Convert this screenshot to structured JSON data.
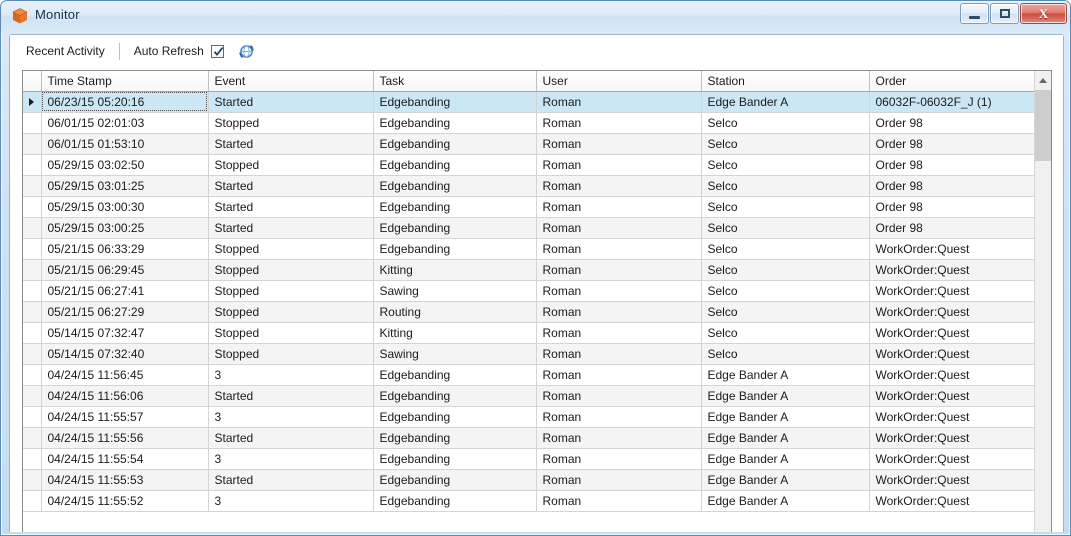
{
  "window": {
    "title": "Monitor",
    "icon": "cube-icon",
    "accent_color": "#e8762c",
    "controls": {
      "minimize": "Minimize",
      "maximize": "Maximize",
      "close": "Close",
      "close_glyph": "X"
    }
  },
  "toolbar": {
    "recent_activity_label": "Recent Activity",
    "auto_refresh_label": "Auto Refresh",
    "auto_refresh_checked": true,
    "refresh_icon": "refresh-icon"
  },
  "grid": {
    "columns": [
      "Time Stamp",
      "Event",
      "Task",
      "User",
      "Station",
      "Order"
    ],
    "selected_row_index": 0,
    "selection_color": "#cbe7f6",
    "rows": [
      {
        "timestamp": "06/23/15 05:20:16",
        "event": "Started",
        "task": "Edgebanding",
        "user": "Roman",
        "station": "Edge Bander A",
        "order": "06032F-06032F_J (1)"
      },
      {
        "timestamp": "06/01/15 02:01:03",
        "event": "Stopped",
        "task": "Edgebanding",
        "user": "Roman",
        "station": "Selco",
        "order": "Order 98"
      },
      {
        "timestamp": "06/01/15 01:53:10",
        "event": "Started",
        "task": "Edgebanding",
        "user": "Roman",
        "station": "Selco",
        "order": "Order 98"
      },
      {
        "timestamp": "05/29/15 03:02:50",
        "event": "Stopped",
        "task": "Edgebanding",
        "user": "Roman",
        "station": "Selco",
        "order": "Order 98"
      },
      {
        "timestamp": "05/29/15 03:01:25",
        "event": "Started",
        "task": "Edgebanding",
        "user": "Roman",
        "station": "Selco",
        "order": "Order 98"
      },
      {
        "timestamp": "05/29/15 03:00:30",
        "event": "Started",
        "task": "Edgebanding",
        "user": "Roman",
        "station": "Selco",
        "order": "Order 98"
      },
      {
        "timestamp": "05/29/15 03:00:25",
        "event": "Started",
        "task": "Edgebanding",
        "user": "Roman",
        "station": "Selco",
        "order": "Order 98"
      },
      {
        "timestamp": "05/21/15 06:33:29",
        "event": "Stopped",
        "task": "Edgebanding",
        "user": "Roman",
        "station": "Selco",
        "order": "WorkOrder:Quest"
      },
      {
        "timestamp": "05/21/15 06:29:45",
        "event": "Stopped",
        "task": "Kitting",
        "user": "Roman",
        "station": "Selco",
        "order": "WorkOrder:Quest"
      },
      {
        "timestamp": "05/21/15 06:27:41",
        "event": "Stopped",
        "task": "Sawing",
        "user": "Roman",
        "station": "Selco",
        "order": "WorkOrder:Quest"
      },
      {
        "timestamp": "05/21/15 06:27:29",
        "event": "Stopped",
        "task": "Routing",
        "user": "Roman",
        "station": "Selco",
        "order": "WorkOrder:Quest"
      },
      {
        "timestamp": "05/14/15 07:32:47",
        "event": "Stopped",
        "task": "Kitting",
        "user": "Roman",
        "station": "Selco",
        "order": "WorkOrder:Quest"
      },
      {
        "timestamp": "05/14/15 07:32:40",
        "event": "Stopped",
        "task": "Sawing",
        "user": "Roman",
        "station": "Selco",
        "order": "WorkOrder:Quest"
      },
      {
        "timestamp": "04/24/15 11:56:45",
        "event": "3",
        "task": "Edgebanding",
        "user": "Roman",
        "station": "Edge Bander A",
        "order": "WorkOrder:Quest"
      },
      {
        "timestamp": "04/24/15 11:56:06",
        "event": "Started",
        "task": "Edgebanding",
        "user": "Roman",
        "station": "Edge Bander A",
        "order": "WorkOrder:Quest"
      },
      {
        "timestamp": "04/24/15 11:55:57",
        "event": "3",
        "task": "Edgebanding",
        "user": "Roman",
        "station": "Edge Bander A",
        "order": "WorkOrder:Quest"
      },
      {
        "timestamp": "04/24/15 11:55:56",
        "event": "Started",
        "task": "Edgebanding",
        "user": "Roman",
        "station": "Edge Bander A",
        "order": "WorkOrder:Quest"
      },
      {
        "timestamp": "04/24/15 11:55:54",
        "event": "3",
        "task": "Edgebanding",
        "user": "Roman",
        "station": "Edge Bander A",
        "order": "WorkOrder:Quest"
      },
      {
        "timestamp": "04/24/15 11:55:53",
        "event": "Started",
        "task": "Edgebanding",
        "user": "Roman",
        "station": "Edge Bander A",
        "order": "WorkOrder:Quest"
      },
      {
        "timestamp": "04/24/15 11:55:52",
        "event": "3",
        "task": "Edgebanding",
        "user": "Roman",
        "station": "Edge Bander A",
        "order": "WorkOrder:Quest"
      }
    ]
  },
  "scrollbar": {
    "up_arrow": "scroll-up-arrow",
    "thumb": "scroll-thumb"
  }
}
